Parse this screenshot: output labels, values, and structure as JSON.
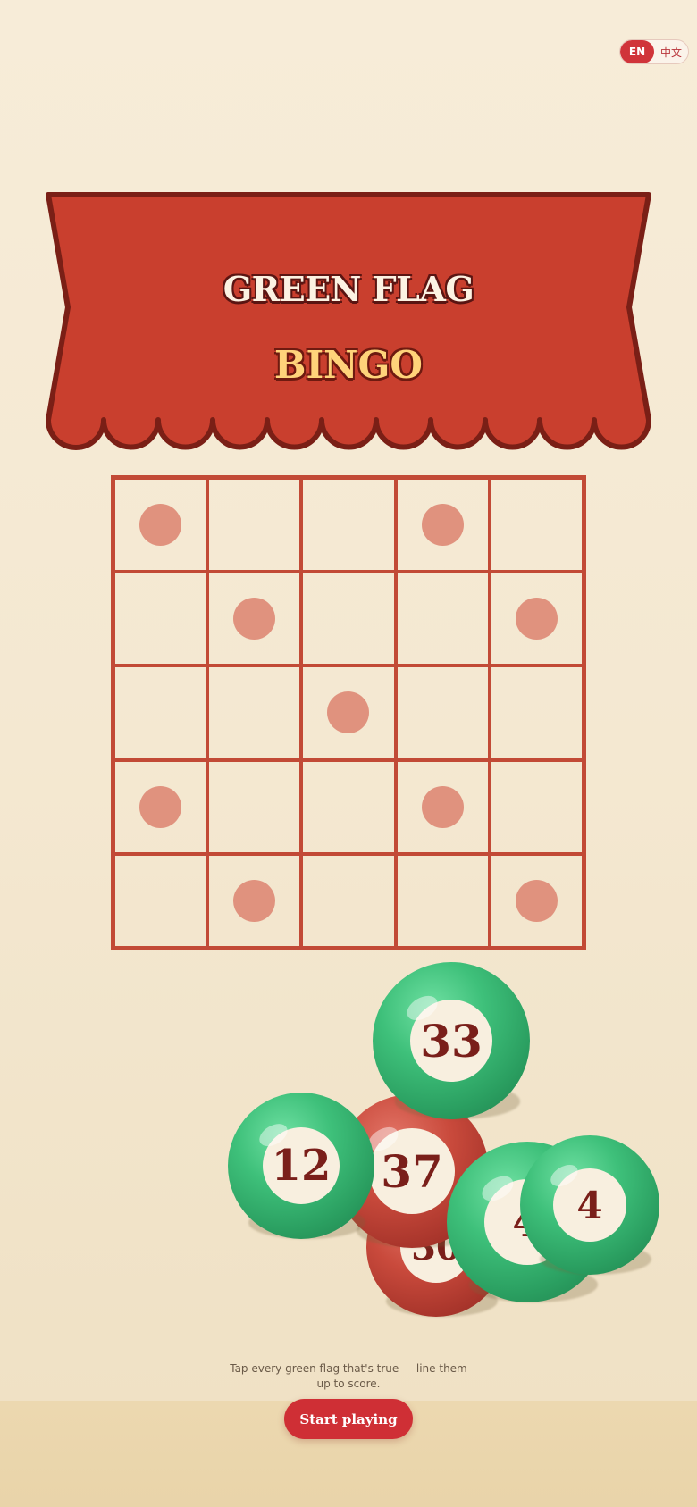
{
  "language_toggle": {
    "options": [
      {
        "label": "EN",
        "active": true
      },
      {
        "label": "中文",
        "active": false
      }
    ]
  },
  "banner": {
    "title_line1": "GREEN FLAG",
    "title_line2": "BINGO"
  },
  "bingo_board": {
    "rows": 5,
    "cols": 5,
    "dot_pattern": [
      [
        1,
        0,
        0,
        1,
        0
      ],
      [
        0,
        1,
        0,
        0,
        1
      ],
      [
        0,
        0,
        1,
        0,
        0
      ],
      [
        1,
        0,
        0,
        1,
        0
      ],
      [
        0,
        1,
        0,
        0,
        1
      ]
    ]
  },
  "balls": [
    {
      "number": "30",
      "color": "red"
    },
    {
      "number": "37",
      "color": "red"
    },
    {
      "number": "33",
      "color": "green"
    },
    {
      "number": "12",
      "color": "green"
    },
    {
      "number": "4",
      "color": "green"
    },
    {
      "number": "4",
      "color": "green"
    }
  ],
  "hint_text": "Tap every green flag that's true — line them up to score.",
  "start_button": {
    "label": "Start playing"
  },
  "colors": {
    "accent_red": "#cf2f35",
    "banner_red": "#c93f2e",
    "ball_green": "#3ec07a",
    "ball_red": "#c94a3c",
    "dot": "#e0927e"
  }
}
